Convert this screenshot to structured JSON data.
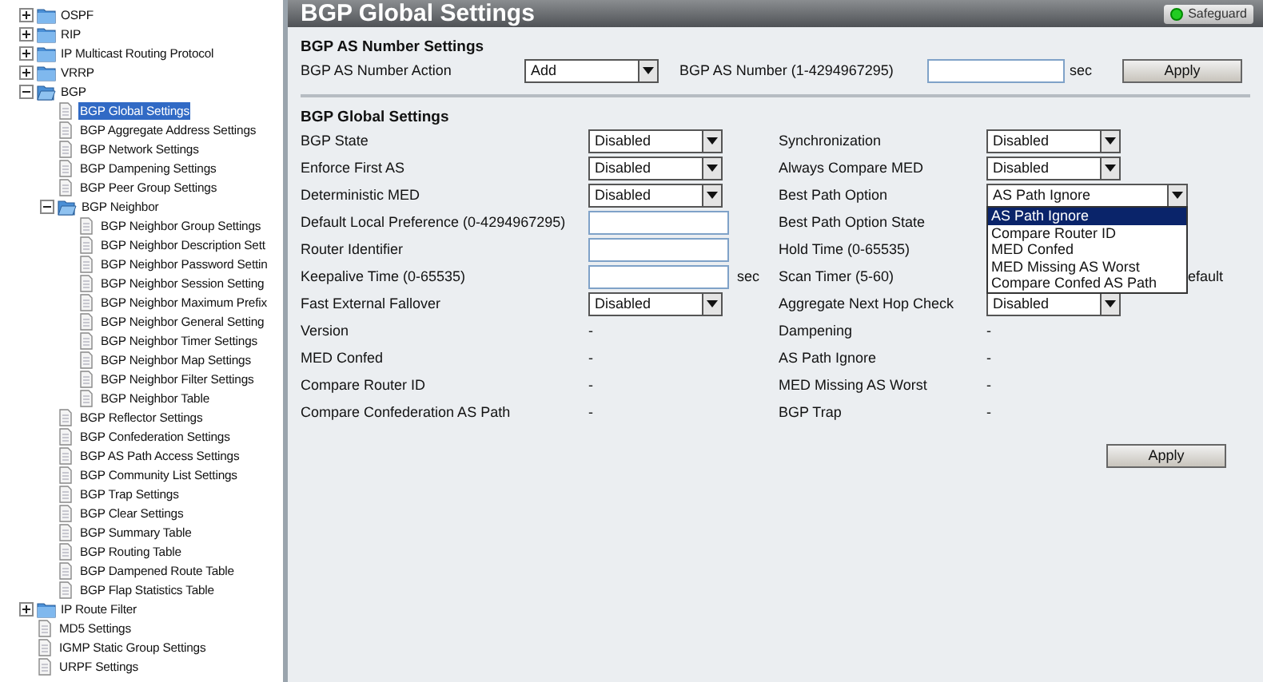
{
  "sidebar": {
    "tree": [
      {
        "label": "OSPF",
        "kind": "folder",
        "expanded": false
      },
      {
        "label": "RIP",
        "kind": "folder",
        "expanded": false
      },
      {
        "label": "IP Multicast Routing Protocol",
        "kind": "folder",
        "expanded": false
      },
      {
        "label": "VRRP",
        "kind": "folder",
        "expanded": false
      },
      {
        "label": "BGP",
        "kind": "folder",
        "expanded": true,
        "children": [
          {
            "label": "BGP Global Settings",
            "kind": "page",
            "selected": true
          },
          {
            "label": "BGP Aggregate Address Settings",
            "kind": "page",
            "selected": false
          },
          {
            "label": "BGP Network Settings",
            "kind": "page",
            "selected": false
          },
          {
            "label": "BGP Dampening Settings",
            "kind": "page",
            "selected": false
          },
          {
            "label": "BGP Peer Group Settings",
            "kind": "page",
            "selected": false
          },
          {
            "label": "BGP Neighbor",
            "kind": "folder",
            "expanded": true,
            "children": [
              {
                "label": "BGP Neighbor Group Settings",
                "kind": "page",
                "selected": false
              },
              {
                "label": "BGP Neighbor Description Sett",
                "kind": "page",
                "selected": false
              },
              {
                "label": "BGP Neighbor Password Settin",
                "kind": "page",
                "selected": false
              },
              {
                "label": "BGP Neighbor Session Setting",
                "kind": "page",
                "selected": false
              },
              {
                "label": "BGP Neighbor Maximum Prefix",
                "kind": "page",
                "selected": false
              },
              {
                "label": "BGP Neighbor General Setting",
                "kind": "page",
                "selected": false
              },
              {
                "label": "BGP Neighbor Timer Settings",
                "kind": "page",
                "selected": false
              },
              {
                "label": "BGP Neighbor Map Settings",
                "kind": "page",
                "selected": false
              },
              {
                "label": "BGP Neighbor Filter Settings",
                "kind": "page",
                "selected": false
              },
              {
                "label": "BGP Neighbor Table",
                "kind": "page",
                "selected": false
              }
            ]
          },
          {
            "label": "BGP Reflector Settings",
            "kind": "page",
            "selected": false
          },
          {
            "label": "BGP Confederation Settings",
            "kind": "page",
            "selected": false
          },
          {
            "label": "BGP AS Path Access Settings",
            "kind": "page",
            "selected": false
          },
          {
            "label": "BGP Community List Settings",
            "kind": "page",
            "selected": false
          },
          {
            "label": "BGP Trap Settings",
            "kind": "page",
            "selected": false
          },
          {
            "label": "BGP Clear Settings",
            "kind": "page",
            "selected": false
          },
          {
            "label": "BGP Summary Table",
            "kind": "page",
            "selected": false
          },
          {
            "label": "BGP Routing Table",
            "kind": "page",
            "selected": false
          },
          {
            "label": "BGP Dampened Route Table",
            "kind": "page",
            "selected": false
          },
          {
            "label": "BGP Flap Statistics Table",
            "kind": "page",
            "selected": false
          }
        ]
      },
      {
        "label": "IP Route Filter",
        "kind": "folder",
        "expanded": false
      },
      {
        "label": "MD5 Settings",
        "kind": "page",
        "selected": false
      },
      {
        "label": "IGMP Static Group Settings",
        "kind": "page",
        "selected": false
      },
      {
        "label": "URPF Settings",
        "kind": "page",
        "selected": false
      }
    ]
  },
  "header": {
    "title": "BGP Global Settings",
    "badge": "Safeguard"
  },
  "as_number": {
    "heading": "BGP AS Number Settings",
    "action_label": "BGP AS Number Action",
    "action_value": "Add",
    "number_label": "BGP AS Number (1-4294967295)",
    "unit": "sec",
    "button": "Apply"
  },
  "global": {
    "heading": "BGP Global Settings",
    "rows": [
      {
        "left": {
          "label": "BGP State",
          "kind": "select",
          "value": "Disabled"
        },
        "right": {
          "label": "Synchronization",
          "kind": "select",
          "value": "Disabled"
        }
      },
      {
        "left": {
          "label": "Enforce First AS",
          "kind": "select",
          "value": "Disabled"
        },
        "right": {
          "label": "Always Compare MED",
          "kind": "select",
          "value": "Disabled"
        }
      },
      {
        "left": {
          "label": "Deterministic MED",
          "kind": "select",
          "value": "Disabled"
        },
        "right": {
          "label": "Best Path Option",
          "kind": "dropdown",
          "value": "AS Path Ignore",
          "options": [
            {
              "label": "AS Path Ignore",
              "selected": true
            },
            {
              "label": "Compare Router ID",
              "selected": false
            },
            {
              "label": "MED Confed",
              "selected": false
            },
            {
              "label": "MED Missing AS Worst",
              "selected": false
            },
            {
              "label": "Compare Confed AS Path",
              "selected": false
            }
          ]
        }
      },
      {
        "left": {
          "label": "Default Local Preference (0-4294967295)",
          "kind": "input"
        },
        "right": {
          "label": "Best Path Option State",
          "kind": "label"
        }
      },
      {
        "left": {
          "label": "Router Identifier",
          "kind": "input"
        },
        "right": {
          "label": "Hold Time (0-65535)",
          "kind": "label"
        }
      },
      {
        "left": {
          "label": "Keepalive Time (0-65535)",
          "kind": "input",
          "unit": "sec"
        },
        "right": {
          "label": "Scan Timer (5-60)",
          "kind": "label",
          "tail": "efault"
        }
      },
      {
        "left": {
          "label": "Fast External Fallover",
          "kind": "select",
          "value": "Disabled"
        },
        "right": {
          "label": "Aggregate Next Hop Check",
          "kind": "select",
          "value": "Disabled"
        }
      },
      {
        "left": {
          "label": "Version",
          "kind": "text",
          "value": "-"
        },
        "right": {
          "label": "Dampening",
          "kind": "text",
          "value": "-"
        }
      },
      {
        "left": {
          "label": "MED Confed",
          "kind": "text",
          "value": "-"
        },
        "right": {
          "label": "AS Path Ignore",
          "kind": "text",
          "value": "-"
        }
      },
      {
        "left": {
          "label": "Compare Router ID",
          "kind": "text",
          "value": "-"
        },
        "right": {
          "label": "MED Missing AS Worst",
          "kind": "text",
          "value": "-"
        }
      },
      {
        "left": {
          "label": "Compare Confederation AS Path",
          "kind": "text",
          "value": "-"
        },
        "right": {
          "label": "BGP Trap",
          "kind": "text",
          "value": "-"
        }
      }
    ],
    "button": "Apply"
  }
}
